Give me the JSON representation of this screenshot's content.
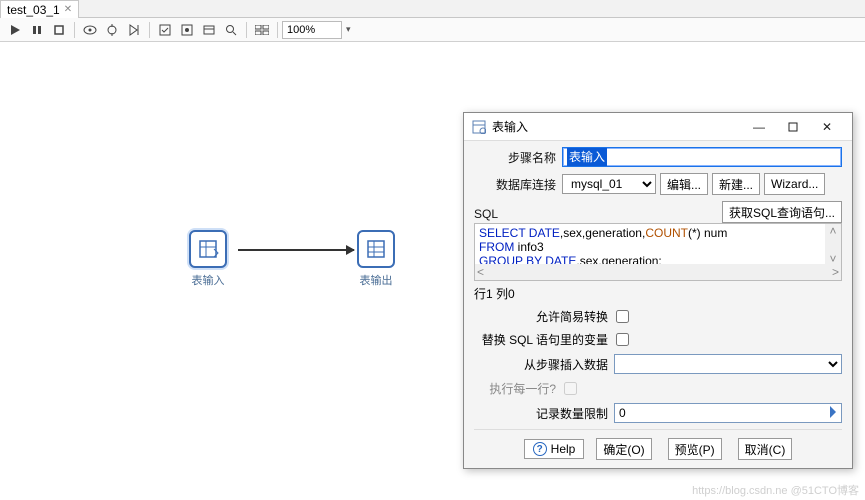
{
  "tab": {
    "title": "test_03_1"
  },
  "toolbar": {
    "zoom": "100%"
  },
  "nodes": {
    "input": {
      "label": "表输入"
    },
    "output": {
      "label": "表输出"
    }
  },
  "dialog": {
    "title": "表输入",
    "labels": {
      "step_name": "步骤名称",
      "db_conn": "数据库连接",
      "sql": "SQL",
      "get_sql_btn": "获取SQL查询语句...",
      "edit_btn": "编辑...",
      "new_btn": "新建...",
      "wizard_btn": "Wizard...",
      "allow_lazy": "允许简易转换",
      "replace_vars": "替换 SQL 语句里的变量",
      "insert_from_step": "从步骤插入数据",
      "each_row": "执行每一行?",
      "limit": "记录数量限制",
      "help": "Help",
      "ok": "确定(O)",
      "preview": "预览(P)",
      "cancel": "取消(C)"
    },
    "values": {
      "step_name": "表输入",
      "db_conn": "mysql_01",
      "sql_line1_a": "SELECT DATE",
      "sql_line1_b": ",sex,generation,",
      "sql_line1_c": "COUNT",
      "sql_line1_d": "(*) num",
      "sql_line2_a": "FROM",
      "sql_line2_b": " info3",
      "sql_line3_a": "GROUP BY DATE",
      "sql_line3_b": ",sex,generation;",
      "pos_status": "行1 列0",
      "limit": "0"
    }
  },
  "watermark": "https://blog.csdn.ne @51CTO博客"
}
